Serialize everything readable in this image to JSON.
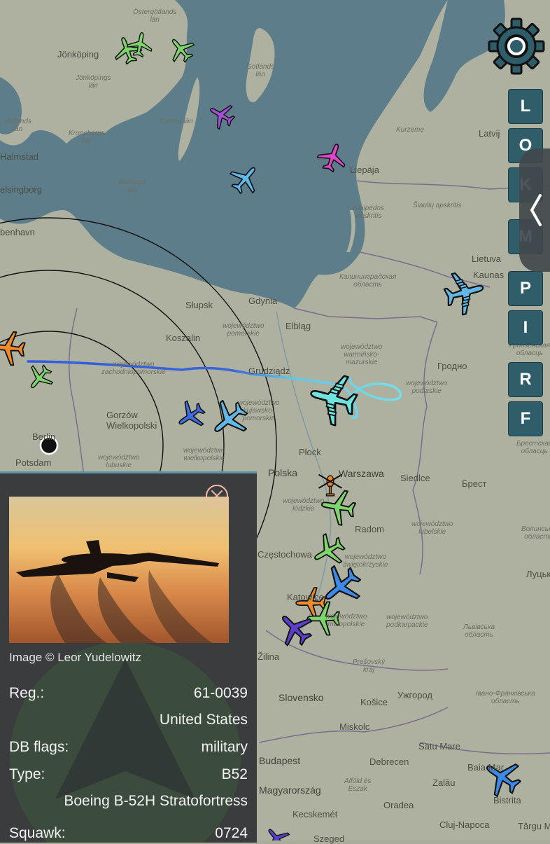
{
  "map": {
    "places": [
      {
        "id": "ostergotlands",
        "text": "Östergötlands\nlän",
        "cls": "it"
      },
      {
        "id": "jonkoping",
        "text": "Jönköping"
      },
      {
        "id": "jonkopings-lan",
        "text": "Jönköpings\nlän",
        "cls": "it"
      },
      {
        "id": "gotlands-lan",
        "text": "Gotlands\nlän",
        "cls": "it"
      },
      {
        "id": "kalmar-lan",
        "text": "Kalmar län",
        "cls": "it"
      },
      {
        "id": "kronobergs-lan",
        "text": "Kronobergs\nlän",
        "cls": "it"
      },
      {
        "id": "hallands-lan",
        "text": "Hallands\nlän",
        "cls": "it"
      },
      {
        "id": "halmstad",
        "text": "Halmstad"
      },
      {
        "id": "helsingborg",
        "text": "elsingborg"
      },
      {
        "id": "blekinge-lan",
        "text": "Blekinge\nlän",
        "cls": "it"
      },
      {
        "id": "kobenhavn",
        "text": "benhavn"
      },
      {
        "id": "kurzeme",
        "text": "Kurzeme",
        "cls": "it"
      },
      {
        "id": "latvija",
        "text": "Latvij"
      },
      {
        "id": "liepaja",
        "text": "Liepāja"
      },
      {
        "id": "klaipedos",
        "text": "Klaipėdos\napskritis",
        "cls": "it"
      },
      {
        "id": "siauliu",
        "text": "Šiaulių apskritis",
        "cls": "it"
      },
      {
        "id": "lietuva",
        "text": "Lietuva"
      },
      {
        "id": "kaunas",
        "text": "Kaunas"
      },
      {
        "id": "kaliningrad",
        "text": "Калининградская\nобласть",
        "cls": "it"
      },
      {
        "id": "slupsk",
        "text": "Słupsk"
      },
      {
        "id": "gdynia",
        "text": "Gdynia"
      },
      {
        "id": "koszalin",
        "text": "Koszalin"
      },
      {
        "id": "woj-pomorskie",
        "text": "województwo\npomorskie",
        "cls": "it"
      },
      {
        "id": "elblag",
        "text": "Elbląg"
      },
      {
        "id": "woj-warminsko",
        "text": "województwo\nwarmińsko-\nmazurskie",
        "cls": "it"
      },
      {
        "id": "grodno",
        "text": "Гродно"
      },
      {
        "id": "grodno-obl",
        "text": "Гродзенская\nобласць",
        "cls": "it"
      },
      {
        "id": "woj-podlaskie",
        "text": "województwo\npodlaskie",
        "cls": "it"
      },
      {
        "id": "woj-zachodnio",
        "text": "województwo\nzachodniopomorskie",
        "cls": "it"
      },
      {
        "id": "grudziadz",
        "text": "Grudziądz"
      },
      {
        "id": "woj-kujawsko",
        "text": "województwo\nkujawsko-\npomorskie",
        "cls": "it"
      },
      {
        "id": "gorzow",
        "text": "Gorzów\nWielkopolski"
      },
      {
        "id": "berlin",
        "text": "Berlin"
      },
      {
        "id": "potsdam",
        "text": "Potsdam"
      },
      {
        "id": "woj-lubuskie",
        "text": "województwo\nlubuskie",
        "cls": "it"
      },
      {
        "id": "woj-wielkopolskie",
        "text": "województwo\nwielkopolskie",
        "cls": "it"
      },
      {
        "id": "plock",
        "text": "Płock"
      },
      {
        "id": "polska",
        "text": "Polska",
        "cls": "big"
      },
      {
        "id": "warszawa",
        "text": "Warszawa",
        "cls": "big"
      },
      {
        "id": "siedlce",
        "text": "Siedlce"
      },
      {
        "id": "brest",
        "text": "Брест"
      },
      {
        "id": "brest-obl",
        "text": "Брестская\nобласць",
        "cls": "it"
      },
      {
        "id": "woj-lodzkie",
        "text": "województwo\nłódzkie",
        "cls": "it"
      },
      {
        "id": "radom",
        "text": "Radom"
      },
      {
        "id": "woj-lubelskie",
        "text": "województwo\nlubelskie",
        "cls": "it"
      },
      {
        "id": "volyn",
        "text": "Волинська\nобласть",
        "cls": "it"
      },
      {
        "id": "czestochowa",
        "text": "Częstochowa"
      },
      {
        "id": "woj-swietokrzyskie",
        "text": "województwo\nświętokrzyskie",
        "cls": "it"
      },
      {
        "id": "lutsk",
        "text": "Луцьк"
      },
      {
        "id": "katowice",
        "text": "Katowice"
      },
      {
        "id": "woj-malopolskie",
        "text": "województwo\nmałopolskie",
        "cls": "it"
      },
      {
        "id": "woj-podkarpackie",
        "text": "województwo\npodkarpackie",
        "cls": "it"
      },
      {
        "id": "lviv-obl",
        "text": "Львівська\nобласть",
        "cls": "it"
      },
      {
        "id": "zilina",
        "text": "Žilina"
      },
      {
        "id": "presovsky",
        "text": "Prešovský\nkraj",
        "cls": "it"
      },
      {
        "id": "slovensko",
        "text": "Slovensko",
        "cls": "big"
      },
      {
        "id": "kosice",
        "text": "Košice"
      },
      {
        "id": "uzhhorod",
        "text": "Ужгород"
      },
      {
        "id": "ivano",
        "text": "Івано-Франківська\nобласть",
        "cls": "it"
      },
      {
        "id": "miskolc",
        "text": "Miskolc"
      },
      {
        "id": "satu-mare",
        "text": "Satu Mare"
      },
      {
        "id": "baia-mare",
        "text": "Baia Mar"
      },
      {
        "id": "budapest",
        "text": "Budapest",
        "cls": "big"
      },
      {
        "id": "debrecen",
        "text": "Debrecen"
      },
      {
        "id": "zalau",
        "text": "Zalău"
      },
      {
        "id": "bistrita",
        "text": "Bistrita"
      },
      {
        "id": "magyarorszag",
        "text": "Magyarország",
        "cls": "big"
      },
      {
        "id": "alfold",
        "text": "Alföld és\nÉszak",
        "cls": "it"
      },
      {
        "id": "oradea",
        "text": "Oradea"
      },
      {
        "id": "kecskemet",
        "text": "Kecskemét"
      },
      {
        "id": "cluj",
        "text": "Cluj-Napoca"
      },
      {
        "id": "targu",
        "text": "Târgu M"
      },
      {
        "id": "szeged",
        "text": "Szeged"
      }
    ]
  },
  "controls": {
    "settings_icon": "gear-icon",
    "buttons": [
      "L",
      "O",
      "K",
      "M",
      "P",
      "I",
      "R",
      "F"
    ],
    "expand_icon": "chevron-left-icon"
  },
  "colors": {
    "track_start": "#3b66d8",
    "track_end": "#74e0ea",
    "selected": "#6fe3e0",
    "panel_bg": "#3a3c3e",
    "accent": "#5b93a8"
  },
  "panel": {
    "close_icon": "close-circle-icon",
    "photo": "b52-silhouette-sunset",
    "credit": "Image © Leor Yudelowitz",
    "rows": [
      {
        "key": "Reg.:",
        "value": "61-0039"
      },
      {
        "key": "",
        "value": "United States"
      },
      {
        "key": "DB flags:",
        "value": "military"
      },
      {
        "key": "Type:",
        "value": "B52"
      },
      {
        "key": "",
        "value": "Boeing B-52H Stratofortress"
      },
      {
        "key": "Squawk:",
        "value": "0724"
      }
    ]
  }
}
